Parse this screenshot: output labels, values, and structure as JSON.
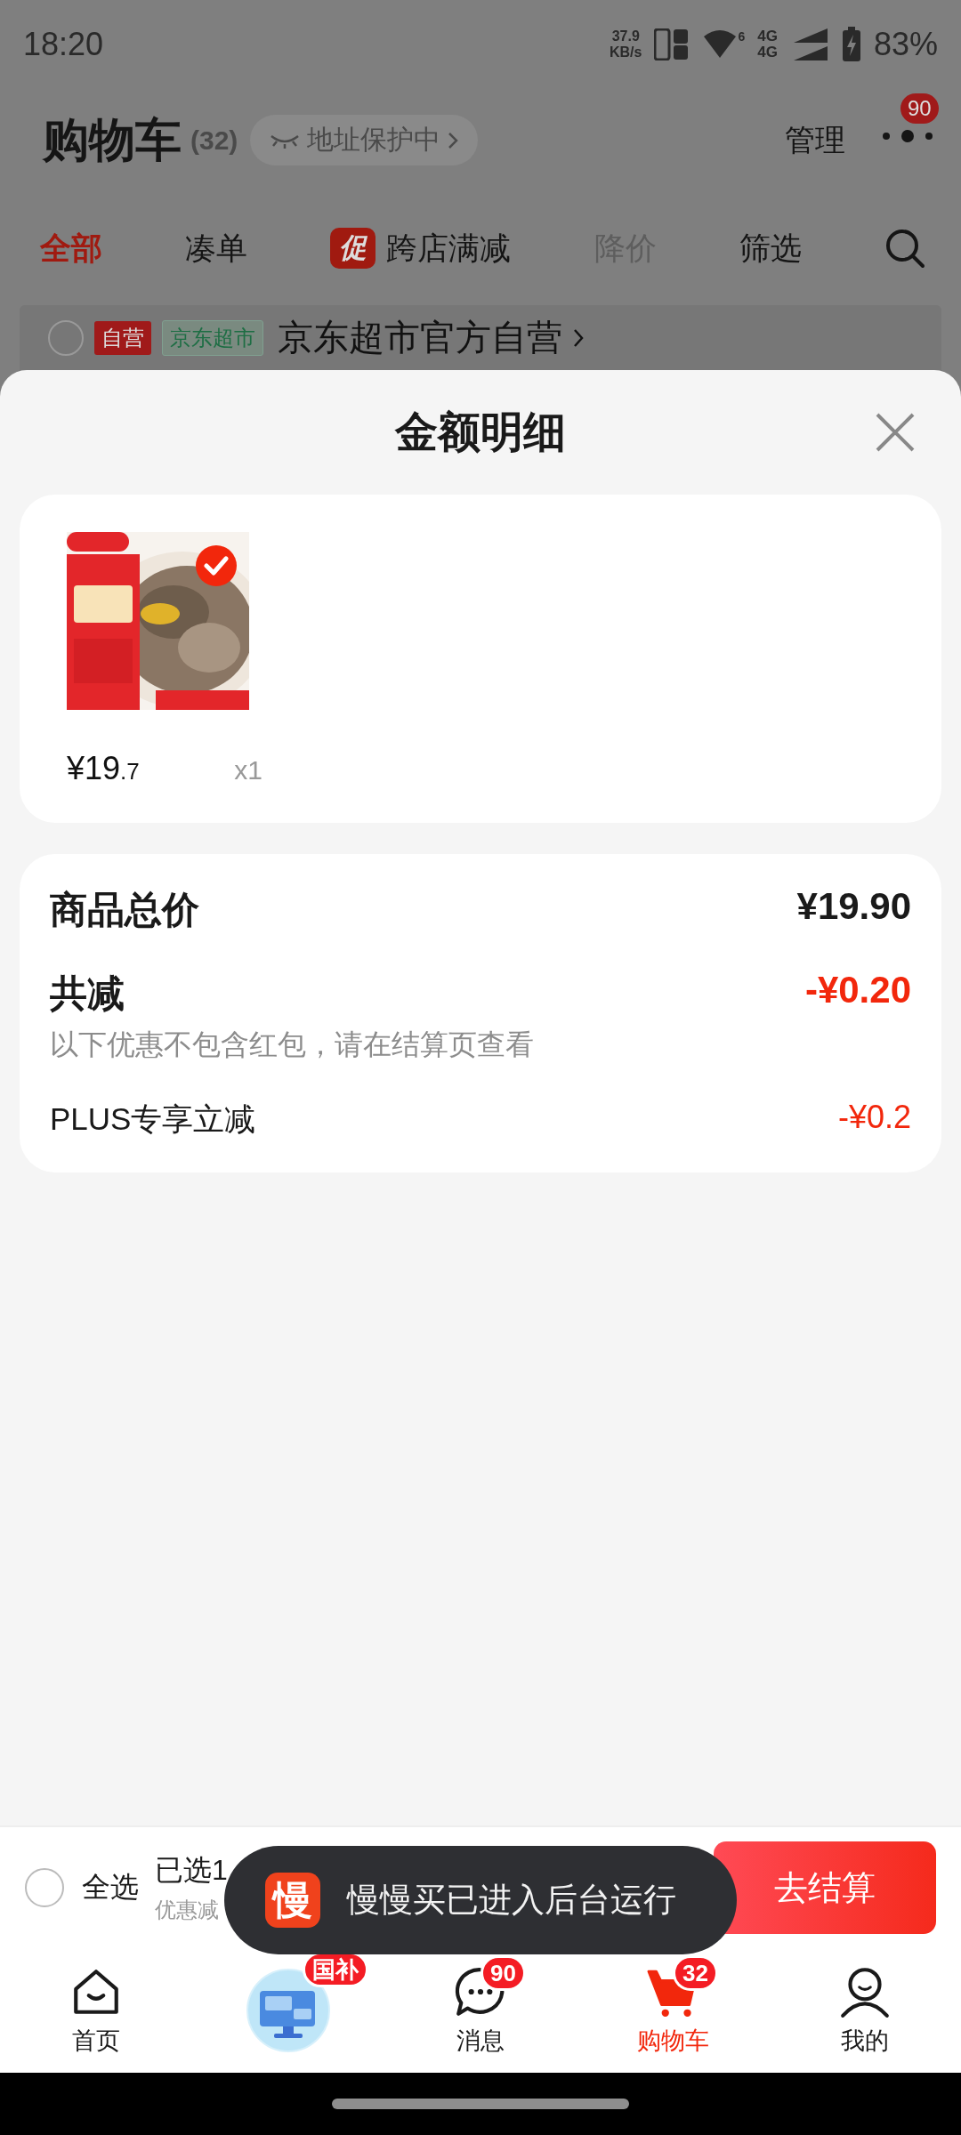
{
  "status_bar": {
    "time": "18:20",
    "net_speed": "37.9",
    "net_unit": "KB/s",
    "wifi_badge": "6",
    "network_1": "4G",
    "network_2": "4G",
    "battery": "83%"
  },
  "header": {
    "title": "购物车",
    "count": "(32)",
    "address_pill": "地址保护中",
    "manage": "管理",
    "more_badge": "90"
  },
  "tabs": [
    {
      "label": "全部",
      "selected": true,
      "disabled": false
    },
    {
      "label": "凑单",
      "selected": false,
      "disabled": false
    },
    {
      "label": "跨店满减",
      "tag": "促",
      "selected": false,
      "disabled": false
    },
    {
      "label": "降价",
      "selected": false,
      "disabled": true
    },
    {
      "label": "筛选",
      "selected": false,
      "disabled": false
    }
  ],
  "store": {
    "checked": false,
    "tags": [
      {
        "text": "自营",
        "kind": "solid"
      },
      {
        "text": "京东超市",
        "kind": "outline"
      }
    ],
    "name": "京东超市官方自营"
  },
  "sheet": {
    "title": "金额明细"
  },
  "items": [
    {
      "kind": "picture",
      "selected": true,
      "price": "¥19",
      "price_decimal": ".7",
      "quantity": "x1"
    }
  ],
  "summary": [
    {
      "kind": "total",
      "label": "商品总价",
      "value": "¥19.90"
    },
    {
      "kind": "discount_total",
      "label": "共减",
      "value": "-¥0.20",
      "note": "以下优惠不包含红包，请在结算页查看"
    },
    {
      "kind": "discount",
      "label": "PLUS专享立减",
      "value": "-¥0.2"
    }
  ],
  "checkout_bar": {
    "select_all": {
      "label": "全选",
      "checked": false
    },
    "selected_count": "已选1",
    "discount": "优惠减",
    "button": "去结算"
  },
  "toast": {
    "app_icon": "慢",
    "message": "慢慢买已进入后台运行"
  },
  "nav": [
    {
      "kind": "home",
      "label": "首页",
      "selected": false
    },
    {
      "kind": "promo",
      "badge": "国补",
      "selected": false
    },
    {
      "kind": "message",
      "label": "消息",
      "badge": "90",
      "selected": false
    },
    {
      "kind": "cart",
      "label": "购物车",
      "badge": "32",
      "selected": true
    },
    {
      "kind": "profile",
      "label": "我的",
      "selected": false
    }
  ]
}
